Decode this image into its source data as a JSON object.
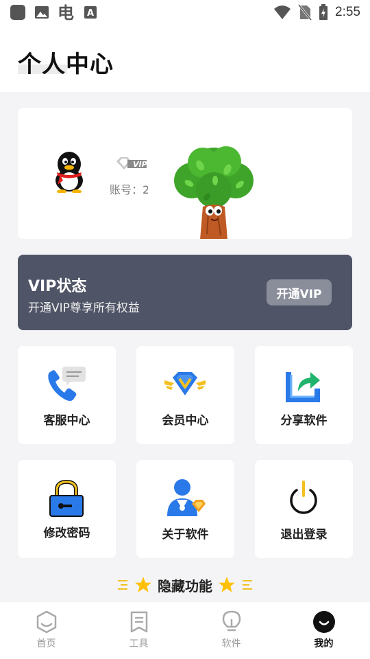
{
  "status_bar": {
    "time": "2:55"
  },
  "header": {
    "title": "个人中心"
  },
  "profile": {
    "vip_badge": "VIP",
    "account_label": "账号：2"
  },
  "vip_card": {
    "title": "VIP状态",
    "subtitle": "开通VIP尊享所有权益",
    "button": "开通VIP"
  },
  "tiles": [
    {
      "label": "客服中心",
      "icon": "customer-service-icon"
    },
    {
      "label": "会员中心",
      "icon": "vip-diamond-icon"
    },
    {
      "label": "分享软件",
      "icon": "share-icon"
    },
    {
      "label": "修改密码",
      "icon": "lock-icon"
    },
    {
      "label": "关于软件",
      "icon": "user-info-icon"
    },
    {
      "label": "退出登录",
      "icon": "power-icon"
    }
  ],
  "hidden_feature": {
    "label": "隐藏功能"
  },
  "bottom_nav": [
    {
      "label": "首页",
      "icon": "home-icon",
      "active": false
    },
    {
      "label": "工具",
      "icon": "tools-icon",
      "active": false
    },
    {
      "label": "软件",
      "icon": "bulb-icon",
      "active": false
    },
    {
      "label": "我的",
      "icon": "smile-icon",
      "active": true
    }
  ],
  "colors": {
    "vip_card_bg": "#4f5466",
    "accent_blue": "#2a79e8",
    "star": "#ffc107"
  }
}
